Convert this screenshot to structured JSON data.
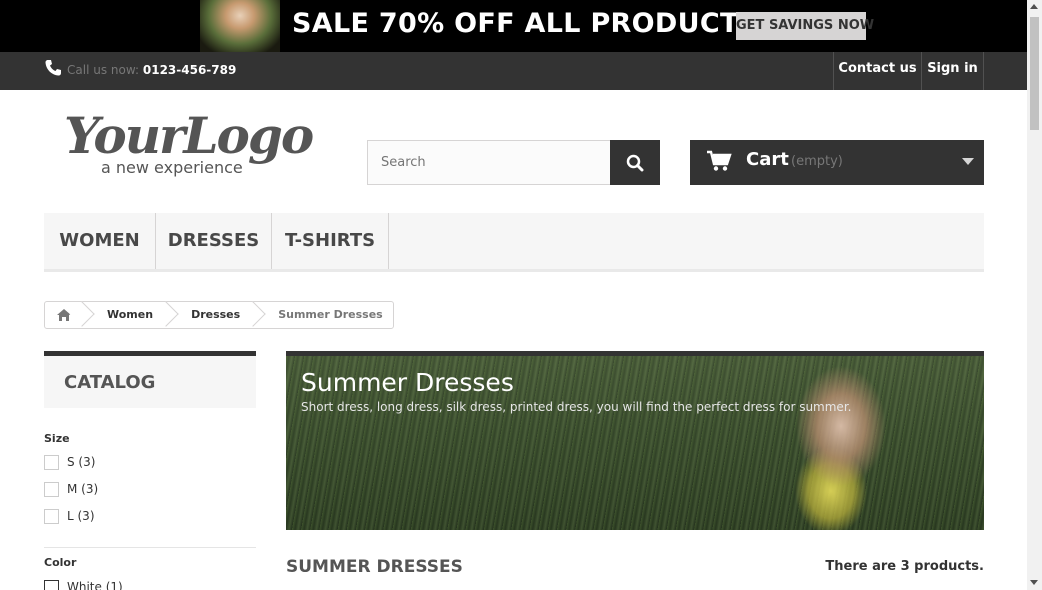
{
  "banner": {
    "headline": "SALE 70% OFF ALL PRODUCTS",
    "button": "GET SAVINGS NOW"
  },
  "topbar": {
    "call_label": "Call us now:",
    "phone": "0123-456-789",
    "contact": "Contact us",
    "signin": "Sign in"
  },
  "logo": {
    "main": "YourLogo",
    "tagline": "a new experience"
  },
  "search": {
    "placeholder": "Search"
  },
  "cart": {
    "label": "Cart",
    "status": "(empty)"
  },
  "menu": {
    "items": [
      "WOMEN",
      "DRESSES",
      "T-SHIRTS"
    ]
  },
  "breadcrumb": {
    "items": [
      "Women",
      "Dresses"
    ],
    "current": "Summer Dresses"
  },
  "sidebar": {
    "catalog_title": "CATALOG",
    "size_title": "Size",
    "sizes": [
      "S (3)",
      "M (3)",
      "L (3)"
    ],
    "color_title": "Color",
    "colors": [
      "White (1)"
    ]
  },
  "category": {
    "title": "Summer Dresses",
    "description": "Short dress, long dress, silk dress, printed dress, you will find the perfect dress for summer."
  },
  "listing": {
    "heading": "SUMMER DRESSES",
    "count": "There are 3 products."
  }
}
